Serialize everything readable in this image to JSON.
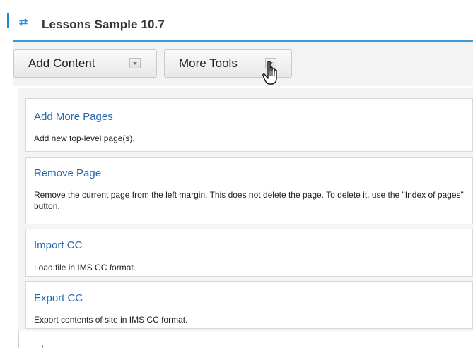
{
  "header": {
    "title": "Lessons Sample 10.7",
    "icon": "sync-arrows-icon",
    "accent_color": "#1e88d8"
  },
  "toolbar": {
    "add_content_label": "Add Content",
    "more_tools_label": "More Tools"
  },
  "menu": {
    "items": [
      {
        "label": "Add More Pages",
        "description": "Add new top-level page(s)."
      },
      {
        "label": "Remove Page",
        "description": "Remove the current page from the left margin. This does not delete the page. To delete it, use the \"Index of pages\" button."
      },
      {
        "label": "Import CC",
        "description": "Load file in IMS CC format."
      },
      {
        "label": "Export CC",
        "description": "Export contents of site in IMS CC format."
      }
    ],
    "link_color": "#2567b6"
  }
}
